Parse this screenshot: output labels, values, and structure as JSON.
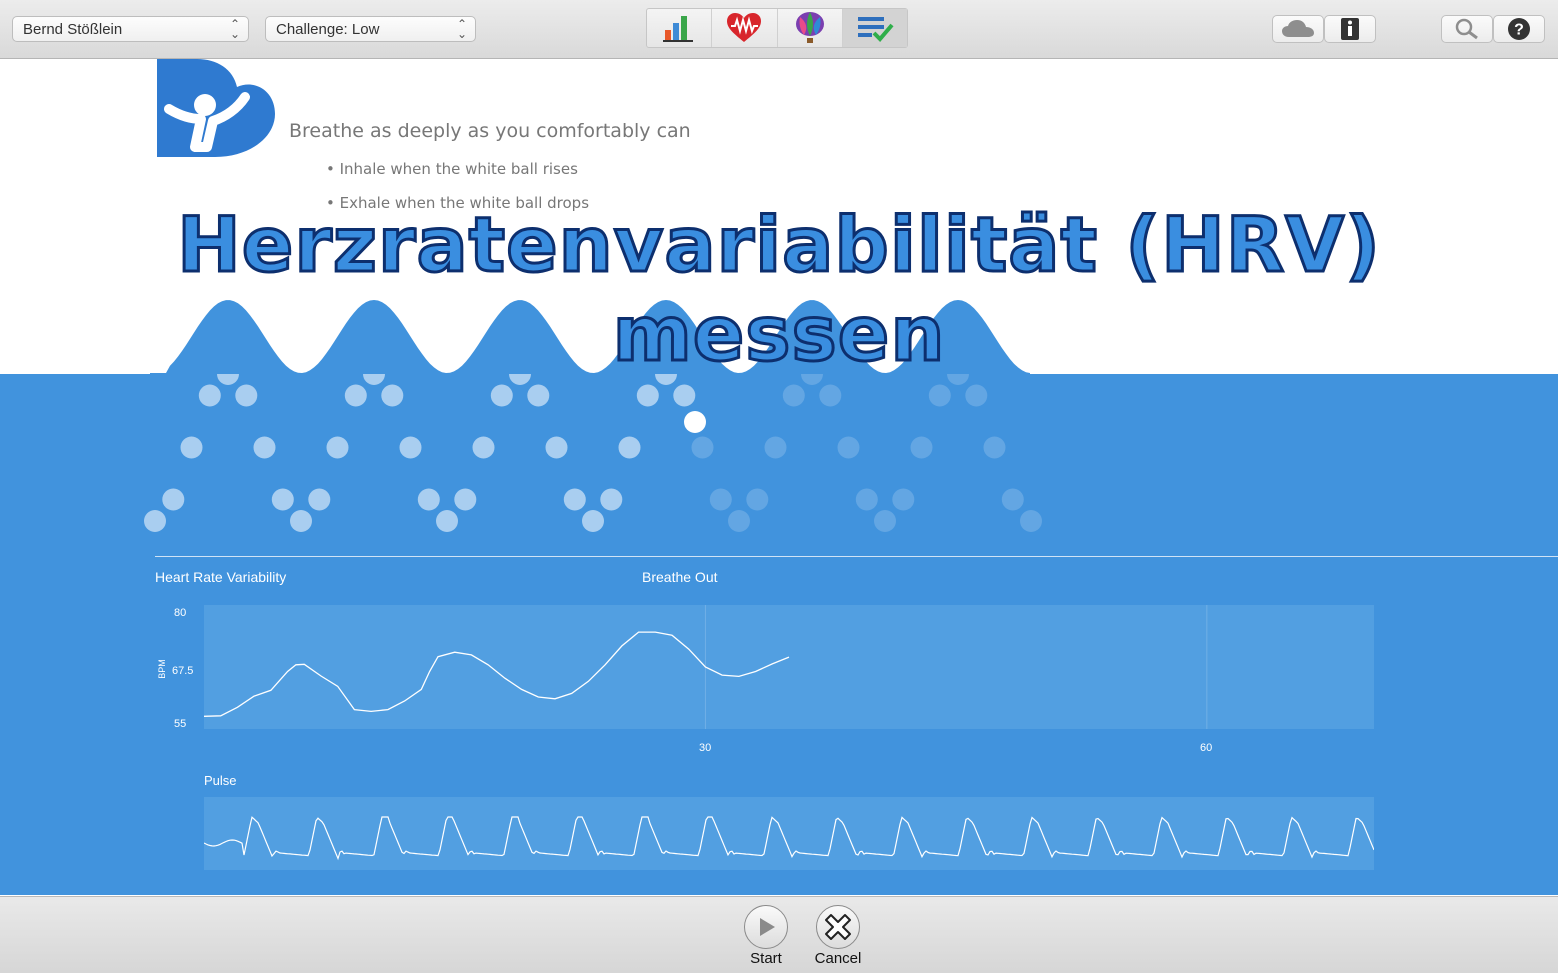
{
  "toolbar": {
    "user_select": "Bernd Stößlein",
    "challenge_select": "Challenge: Low",
    "nav_tabs": [
      "reports",
      "heart-rate",
      "balloon",
      "checklist"
    ],
    "active_tab": "checklist"
  },
  "instructions": {
    "headline": "Breathe as deeply as you comfortably can",
    "bullets": [
      "• Inhale when the white ball rises",
      "• Exhale when the white ball drops"
    ]
  },
  "overlay_title": "Herzratenvariabilität (HRV) messen",
  "hrv_panel": {
    "title": "Heart Rate Variability",
    "status": "Breathe Out",
    "pulse_title": "Pulse"
  },
  "chart_data": [
    {
      "type": "line",
      "title": "Heart Rate Variability",
      "ylabel": "BPM",
      "ylim": [
        55,
        80
      ],
      "xlim": [
        0,
        70
      ],
      "yticks": [
        "80",
        "67.5",
        "55"
      ],
      "xticks": [
        "30",
        "60"
      ],
      "series": [
        {
          "x": [
            0,
            1,
            2,
            3,
            4,
            5,
            5.5,
            6,
            7,
            8,
            9,
            10,
            11,
            12,
            13,
            13.5,
            14,
            15,
            16,
            17,
            18,
            19,
            20,
            21,
            22,
            23,
            24,
            25,
            26,
            27,
            28,
            29,
            30,
            31,
            32,
            33,
            34,
            35
          ],
          "y": [
            56.5,
            56.6,
            58.5,
            61,
            62.3,
            66.5,
            68,
            68.1,
            65.5,
            63.2,
            58,
            57.6,
            58,
            59.9,
            62.5,
            66.5,
            69.8,
            70.8,
            70.2,
            68,
            65,
            62.5,
            60.8,
            60.4,
            61.6,
            64.3,
            68,
            72.2,
            75.3,
            75.3,
            74.6,
            71.5,
            67.5,
            65.7,
            65.4,
            66.5,
            68.2,
            69.7
          ]
        }
      ]
    },
    {
      "type": "line",
      "title": "Pulse",
      "pulse_peaks": 18
    }
  ],
  "bottom": {
    "start_label": "Start",
    "cancel_label": "Cancel"
  },
  "colors": {
    "brand_blue": "#2f7ad0",
    "panel_blue": "#4193dd",
    "title_fill": "#3a8ee0",
    "title_stroke": "#0d2f6e"
  }
}
